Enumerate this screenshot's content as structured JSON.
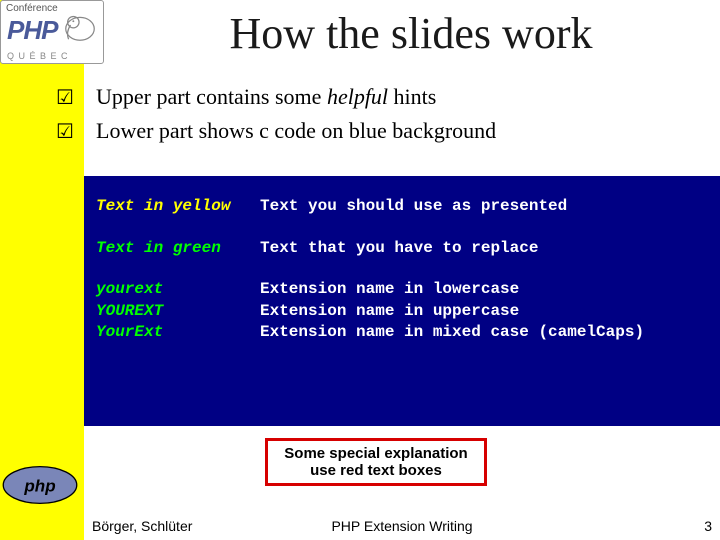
{
  "title": "How the slides work",
  "bullets": [
    {
      "pre": "Upper part contains some ",
      "em": "helpful",
      "post": " hints"
    },
    {
      "pre": "Lower part shows c code on blue background",
      "em": "",
      "post": ""
    }
  ],
  "code": {
    "row1_left": "Text in yellow",
    "row1_right": "Text you should use as presented",
    "row2_left": "Text in green",
    "row2_right": "Text that you have to replace",
    "ext_rows": [
      {
        "left": "yourext",
        "right": "Extension name in lowercase"
      },
      {
        "left": "YOUREXT",
        "right": "Extension name in uppercase"
      },
      {
        "left": "YourExt",
        "right": "Extension name in mixed case (camelCaps)"
      }
    ]
  },
  "redbox": {
    "line1": "Some special explanation",
    "line2": "use red text boxes"
  },
  "footer": {
    "left": "Börger, Schlüter",
    "center": "PHP Extension Writing",
    "right": "3"
  },
  "logo": {
    "conference_small": "Conférence",
    "php": "PHP",
    "quebec": "Q U É B E C"
  },
  "glyphs": {
    "check": "☑"
  }
}
